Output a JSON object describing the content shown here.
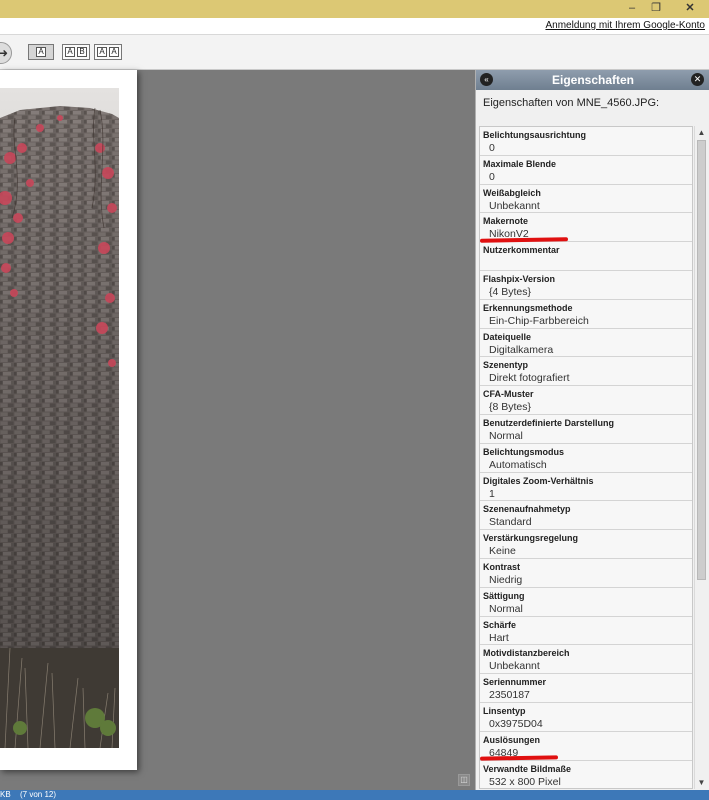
{
  "window": {
    "minimize_glyph": "–",
    "restore_glyph": "❐",
    "close_glyph": "✕"
  },
  "account": {
    "login_link": "Anmeldung mit Ihrem Google-Konto"
  },
  "toolbar": {
    "next_icon": "arrow-right-icon",
    "view_single": "A",
    "view_compare_ab": [
      "A",
      "B"
    ],
    "view_compare_aa": [
      "A",
      "A"
    ]
  },
  "panel": {
    "title": "Eigenschaften",
    "subtitle": "Eigenschaften von MNE_4560.JPG:",
    "collapse_icon": "double-chevron-left-icon",
    "close_icon": "close-icon",
    "properties": [
      {
        "label": "Belichtungsausrichtung",
        "value": "0"
      },
      {
        "label": "Maximale Blende",
        "value": "0"
      },
      {
        "label": "Weißabgleich",
        "value": "Unbekannt"
      },
      {
        "label": "Makernote",
        "value": "NikonV2"
      },
      {
        "label": "Nutzerkommentar",
        "value": ""
      },
      {
        "label": "Flashpix-Version",
        "value": "{4 Bytes}"
      },
      {
        "label": "Erkennungsmethode",
        "value": "Ein-Chip-Farbbereich"
      },
      {
        "label": "Dateiquelle",
        "value": "Digitalkamera"
      },
      {
        "label": "Szenentyp",
        "value": "Direkt fotografiert"
      },
      {
        "label": "CFA-Muster",
        "value": "{8 Bytes}"
      },
      {
        "label": "Benutzerdefinierte Darstellung",
        "value": "Normal"
      },
      {
        "label": "Belichtungsmodus",
        "value": "Automatisch"
      },
      {
        "label": "Digitales Zoom-Verhältnis",
        "value": "1"
      },
      {
        "label": "Szenenaufnahmetyp",
        "value": "Standard"
      },
      {
        "label": "Verstärkungsregelung",
        "value": "Keine"
      },
      {
        "label": "Kontrast",
        "value": "Niedrig"
      },
      {
        "label": "Sättigung",
        "value": "Normal"
      },
      {
        "label": "Schärfe",
        "value": "Hart"
      },
      {
        "label": "Motivdistanzbereich",
        "value": "Unbekannt"
      },
      {
        "label": "Seriennummer",
        "value": "2350187"
      },
      {
        "label": "Linsentyp",
        "value": "0x3975D04"
      },
      {
        "label": "Auslösungen",
        "value": "64849"
      },
      {
        "label": "Verwandte Bildmaße",
        "value": "532 x 800 Pixel"
      }
    ]
  },
  "status": {
    "size_text": "KB",
    "count_text": "(7 von 12)"
  },
  "colors": {
    "titlebar": "#dcc874",
    "panel_header": "#7f8d9d",
    "statusbar": "#3d78b8",
    "highlight_marker": "#e01010"
  }
}
